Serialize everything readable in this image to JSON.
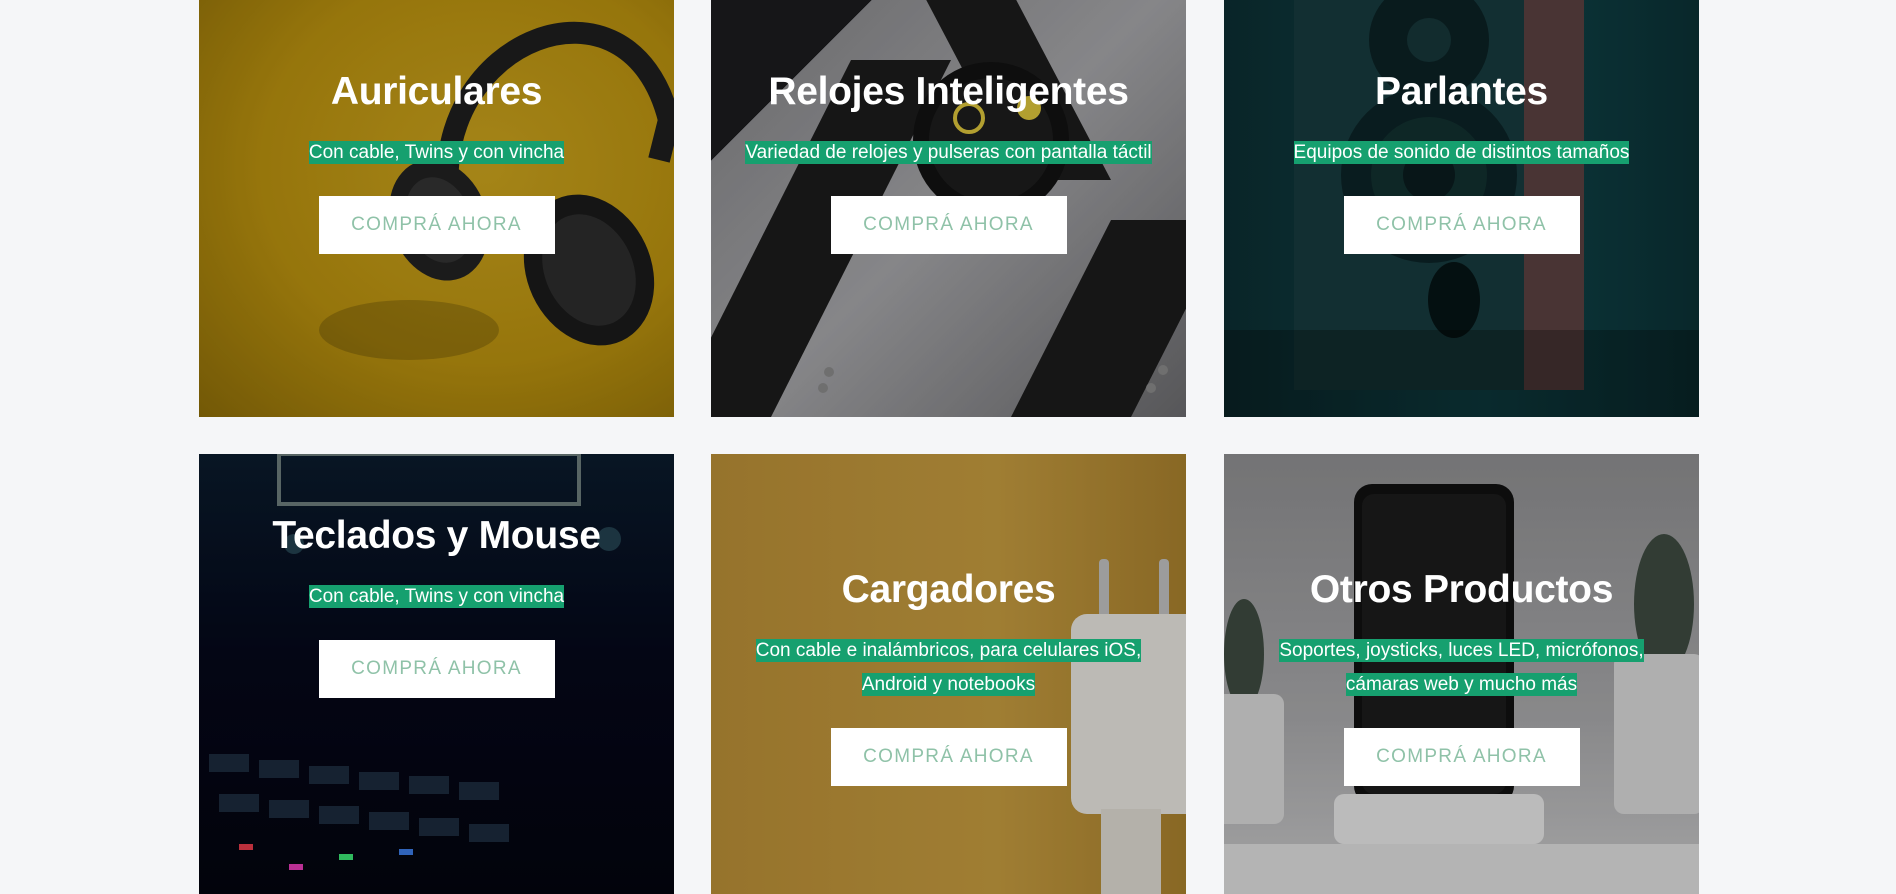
{
  "categories": [
    {
      "title": "Auriculares",
      "description": "Con cable, Twins y con vincha",
      "button": "COMPRÁ AHORA",
      "image": "headphones-image",
      "bg_color": "#c39a16"
    },
    {
      "title": "Relojes Inteligentes",
      "description": "Variedad de relojes y pulseras con pantalla táctil",
      "button": "COMPRÁ AHORA",
      "image": "smartwatch-image",
      "bg_color": "#7d7d80"
    },
    {
      "title": "Parlantes",
      "description": "Equipos de sonido de distintos tamaños",
      "button": "COMPRÁ AHORA",
      "image": "speaker-image",
      "bg_color": "#0f3e42"
    },
    {
      "title": "Teclados y Mouse",
      "description": "Con cable, Twins y con vincha",
      "button": "COMPRÁ AHORA",
      "image": "keyboard-image",
      "bg_color": "#070a1c"
    },
    {
      "title": "Cargadores",
      "description": "Con cable e inalámbricos, para celulares iOS, Android y notebooks",
      "button": "COMPRÁ AHORA",
      "image": "charger-image",
      "bg_color": "#b88d36"
    },
    {
      "title": "Otros Productos",
      "description": "Soportes, joysticks, luces LED, micrófonos, cámaras web y mucho más",
      "button": "COMPRÁ AHORA",
      "image": "phone-stand-image",
      "bg_color": "#9a9a9c"
    }
  ],
  "colors": {
    "page_background": "#f5f6f8",
    "description_highlight": "#16a06f",
    "button_text": "#8fc2a8",
    "button_background": "#ffffff"
  }
}
